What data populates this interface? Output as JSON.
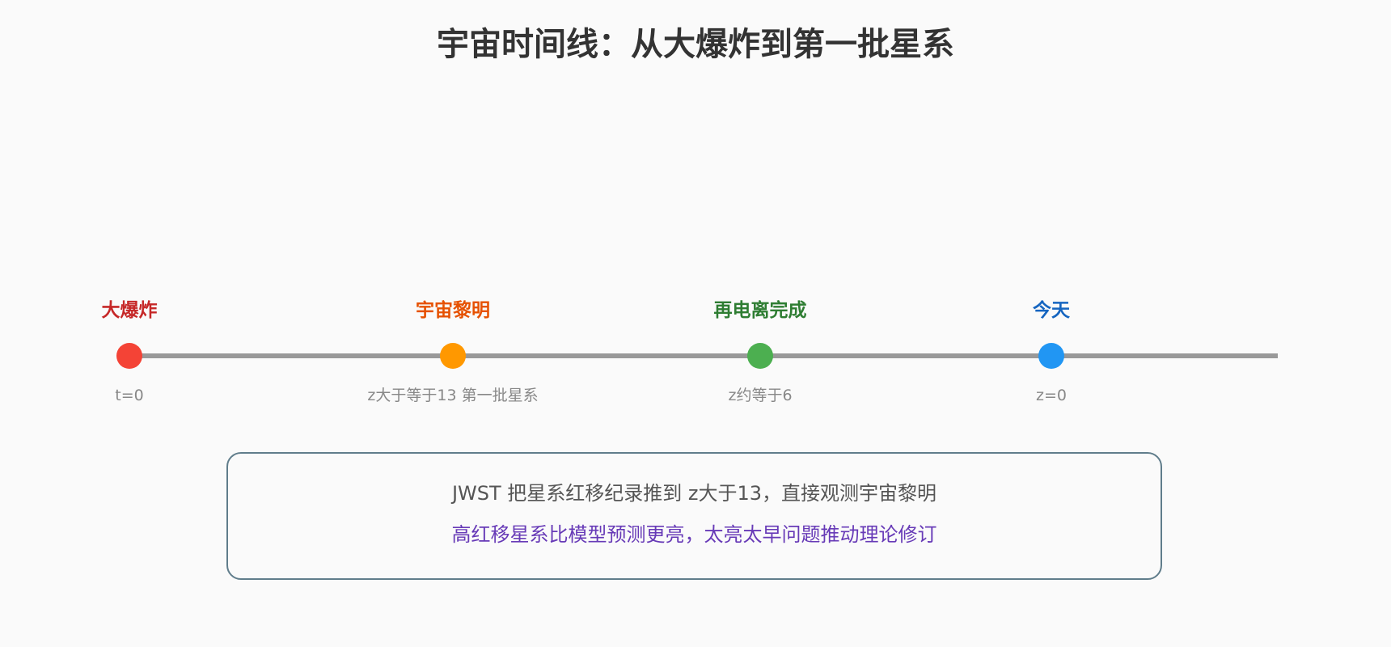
{
  "title": "宇宙时间线：从大爆炸到第一批星系",
  "events": [
    {
      "label": "大爆炸",
      "sub": "t=0",
      "label_color": "#c62828",
      "dot_color": "#f44336"
    },
    {
      "label": "宇宙黎明",
      "sub": "z大于等于13 第一批星系",
      "label_color": "#e65100",
      "dot_color": "#ff9800"
    },
    {
      "label": "再电离完成",
      "sub": "z约等于6",
      "label_color": "#2e7d32",
      "dot_color": "#4caf50"
    },
    {
      "label": "今天",
      "sub": "z=0",
      "label_color": "#1565c0",
      "dot_color": "#2196f3"
    }
  ],
  "note": {
    "line1": "JWST 把星系红移纪录推到 z大于13，直接观测宇宙黎明",
    "line2": "高红移星系比模型预测更亮，太亮太早问题推动理论修订",
    "border_color": "#607d8b",
    "line2_color": "#673ab7"
  }
}
